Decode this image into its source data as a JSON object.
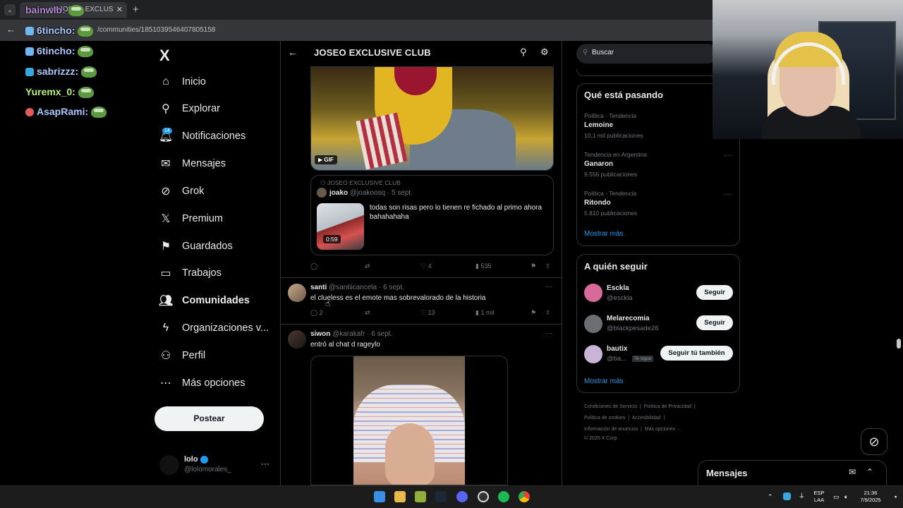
{
  "browser": {
    "tab_title": "ad JOSEO EXCLUS",
    "url": "/communities/1851039546407805158",
    "new_tab_glyph": "+",
    "close_glyph": "✕",
    "back_glyph": "←"
  },
  "chat": [
    {
      "user": "bainwlb:",
      "color": "#b58bd8"
    },
    {
      "user": "6tincho:",
      "color": "#a9c8ff"
    },
    {
      "user": "6tincho:",
      "color": "#a9c8ff"
    },
    {
      "user": "sabrizzz:",
      "color": "#a9c8ff"
    },
    {
      "user": "Yuremx_0:",
      "color": "#b7f07a"
    },
    {
      "user": "AsapRami:",
      "color": "#a9c8ff"
    }
  ],
  "nav": {
    "logo": "X",
    "items": [
      {
        "label": "Inicio",
        "icon": "home-icon",
        "glyph": "⌂"
      },
      {
        "label": "Explorar",
        "icon": "search-icon",
        "glyph": "⚲"
      },
      {
        "label": "Notificaciones",
        "icon": "bell-icon",
        "glyph": "🔔︎"
      },
      {
        "label": "Mensajes",
        "icon": "mail-icon",
        "glyph": "✉"
      },
      {
        "label": "Grok",
        "icon": "grok-icon",
        "glyph": "⊘"
      },
      {
        "label": "Premium",
        "icon": "x-premium-icon",
        "glyph": "𝕏"
      },
      {
        "label": "Guardados",
        "icon": "bookmark-icon",
        "glyph": "⚑"
      },
      {
        "label": "Trabajos",
        "icon": "briefcase-icon",
        "glyph": "▭"
      },
      {
        "label": "Comunidades",
        "icon": "communities-icon",
        "glyph": "👥︎"
      },
      {
        "label": "Organizaciones v...",
        "icon": "lightning-icon",
        "glyph": "ϟ"
      },
      {
        "label": "Perfil",
        "icon": "person-icon",
        "glyph": "⚇"
      },
      {
        "label": "Más opciones",
        "icon": "more-circle-icon",
        "glyph": "⋯"
      }
    ],
    "notif_count": "14",
    "post_label": "Postear",
    "profile": {
      "name": "lolo",
      "handle": "@lolomorales_"
    }
  },
  "main": {
    "title": "JOSEO EXCLUSIVE CLUB",
    "gif_label": "▶ GIF",
    "quote": {
      "community": "JOSEO EXCLUSIVE CLUB",
      "name": "joako",
      "meta": "@joakoosq · 5 sept.",
      "text": "todas son risas pero lo tienen re fichado al primo ahora bahahahaha",
      "duration": "0:59"
    },
    "post1_actions": {
      "reply": "",
      "retweet": "",
      "likes": "4",
      "views": "535"
    },
    "post2": {
      "name": "santi",
      "meta": "@santiicancela · 6 sept.",
      "text": "el clueless es el emote mas sobrevalorado de la historia",
      "replies": "2",
      "likes": "13",
      "views": "1 mil"
    },
    "post3": {
      "name": "siwon",
      "meta": "@karakafr · 6 sept.",
      "text": "entró al chat d rageylo"
    }
  },
  "right": {
    "search_placeholder": "Buscar",
    "trends_title": "Qué está pasando",
    "trends": [
      {
        "meta": "Política · Tendencia",
        "name": "Lemoine",
        "count": "10,1 mil publicaciones"
      },
      {
        "meta": "Tendencia en Argentina",
        "name": "Ganaron",
        "count": "9.556 publicaciones"
      },
      {
        "meta": "Política · Tendencia",
        "name": "Ritondo",
        "count": "5.810 publicaciones"
      }
    ],
    "show_more": "Mostrar más",
    "follow_title": "A quién seguir",
    "follow": [
      {
        "name": "Esckla",
        "handle": "@esckla",
        "button": "Seguir",
        "avatar_color": "#d86a9b"
      },
      {
        "name": "Melarecomia",
        "handle": "@blackpesade26",
        "button": "Seguir",
        "avatar_color": "#6b6f73"
      },
      {
        "name": "bautix",
        "handle": "@ba...",
        "button": "Seguir tú también",
        "avatar_color": "#c9b4d8"
      }
    ],
    "te_sigue": "Te sigue",
    "show_more2": "Mostrar más",
    "footer": {
      "l1a": "Condiciones de Servicio",
      "l1b": "Política de Privacidad",
      "l2a": "Política de cookies",
      "l2b": "Accesibilidad",
      "l3a": "Información de anuncios",
      "l3b": "Más opciones ···",
      "l4": "© 2025 X Corp."
    },
    "messages_title": "Mensajes"
  },
  "taskbar": {
    "lang1": "ESP",
    "lang2": "LAA",
    "time": "21:36",
    "date": "7/9/2025"
  }
}
